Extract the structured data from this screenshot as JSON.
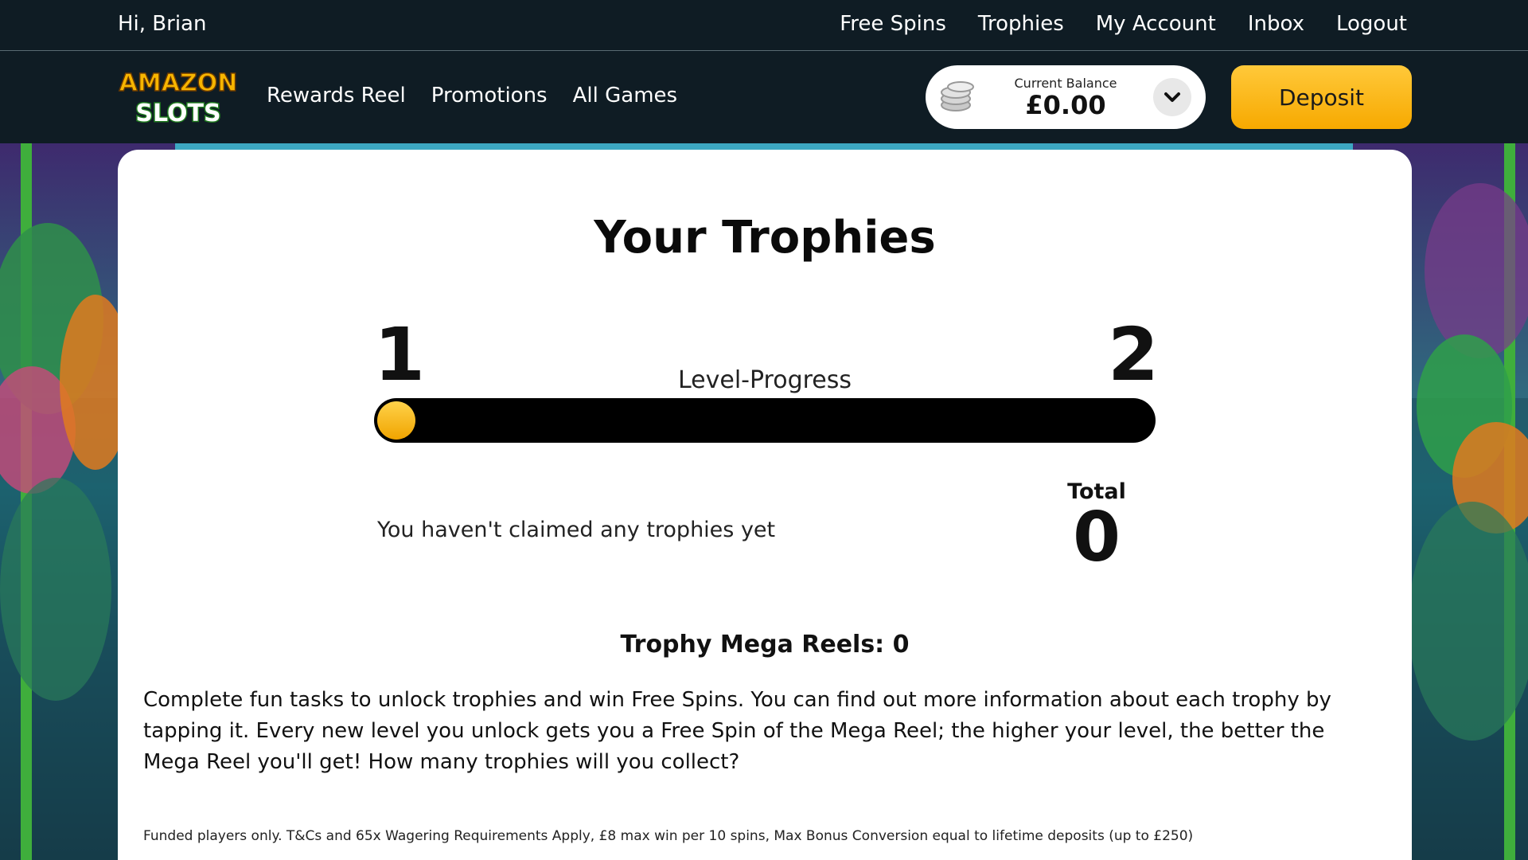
{
  "topbar": {
    "greeting": "Hi, Brian",
    "nav": [
      "Free Spins",
      "Trophies",
      "My Account",
      "Inbox",
      "Logout"
    ]
  },
  "header": {
    "logo_top": "AMAZON",
    "logo_bottom": "SLOTS",
    "nav": [
      "Rewards Reel",
      "Promotions",
      "All Games"
    ],
    "balance_label": "Current Balance",
    "balance_value": "£0.00",
    "deposit_label": "Deposit"
  },
  "trophies": {
    "title": "Your Trophies",
    "level_from": "1",
    "level_to": "2",
    "progress_label": "Level-Progress",
    "progress_fraction": 0,
    "empty_message": "You haven't claimed any trophies yet",
    "total_label": "Total",
    "total_value": "0",
    "mega_reels": "Trophy Mega Reels: 0",
    "description": "Complete fun tasks to unlock trophies and win Free Spins. You can find out more information about each trophy by tapping it. Every new level you unlock gets you a Free Spin of the Mega Reel; the higher your level, the better the Mega Reel you'll get! How many trophies will you collect?",
    "terms": "Funded players only. T&Cs and 65x Wagering Requirements Apply, £8 max win per 10 spins, Max Bonus Conversion equal to lifetime deposits (up to £250)"
  },
  "colors": {
    "header_bg": "#0f1c24",
    "accent": "#f7a900",
    "card_bg": "#ffffff"
  },
  "icons": {
    "balance": "coins-icon",
    "dropdown": "chevron-down-icon"
  }
}
